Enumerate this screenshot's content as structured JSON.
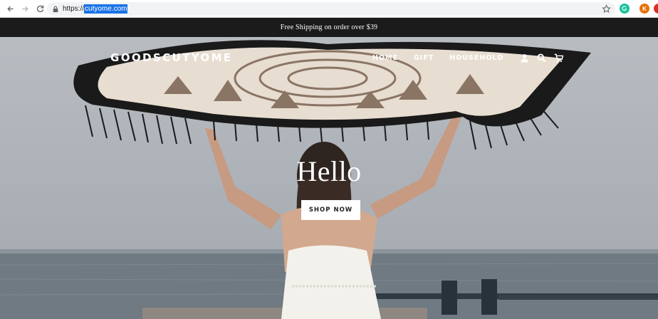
{
  "browser": {
    "url_scheme": "https://",
    "url_host": "cutyome.com",
    "extensions": [
      {
        "name": "grammarly",
        "letter": "",
        "color": "#15c39a"
      },
      {
        "name": "profile",
        "letter": "K",
        "color": "#e8710a"
      },
      {
        "name": "extension",
        "letter": "",
        "color": "#d93025"
      }
    ]
  },
  "announcement": {
    "text": "Free Shipping on order over $39"
  },
  "header": {
    "logo": "GOODSCUTYOME",
    "nav": [
      "HOME",
      "GIFT",
      "HOUSEHOLD"
    ],
    "icons": [
      "account-icon",
      "search-icon",
      "cart-icon"
    ]
  },
  "hero": {
    "title": "Hello",
    "button_label": "SHOP NOW"
  },
  "colors": {
    "announcement_bg": "#1b1b1b",
    "url_highlight": "#1a73e8"
  }
}
